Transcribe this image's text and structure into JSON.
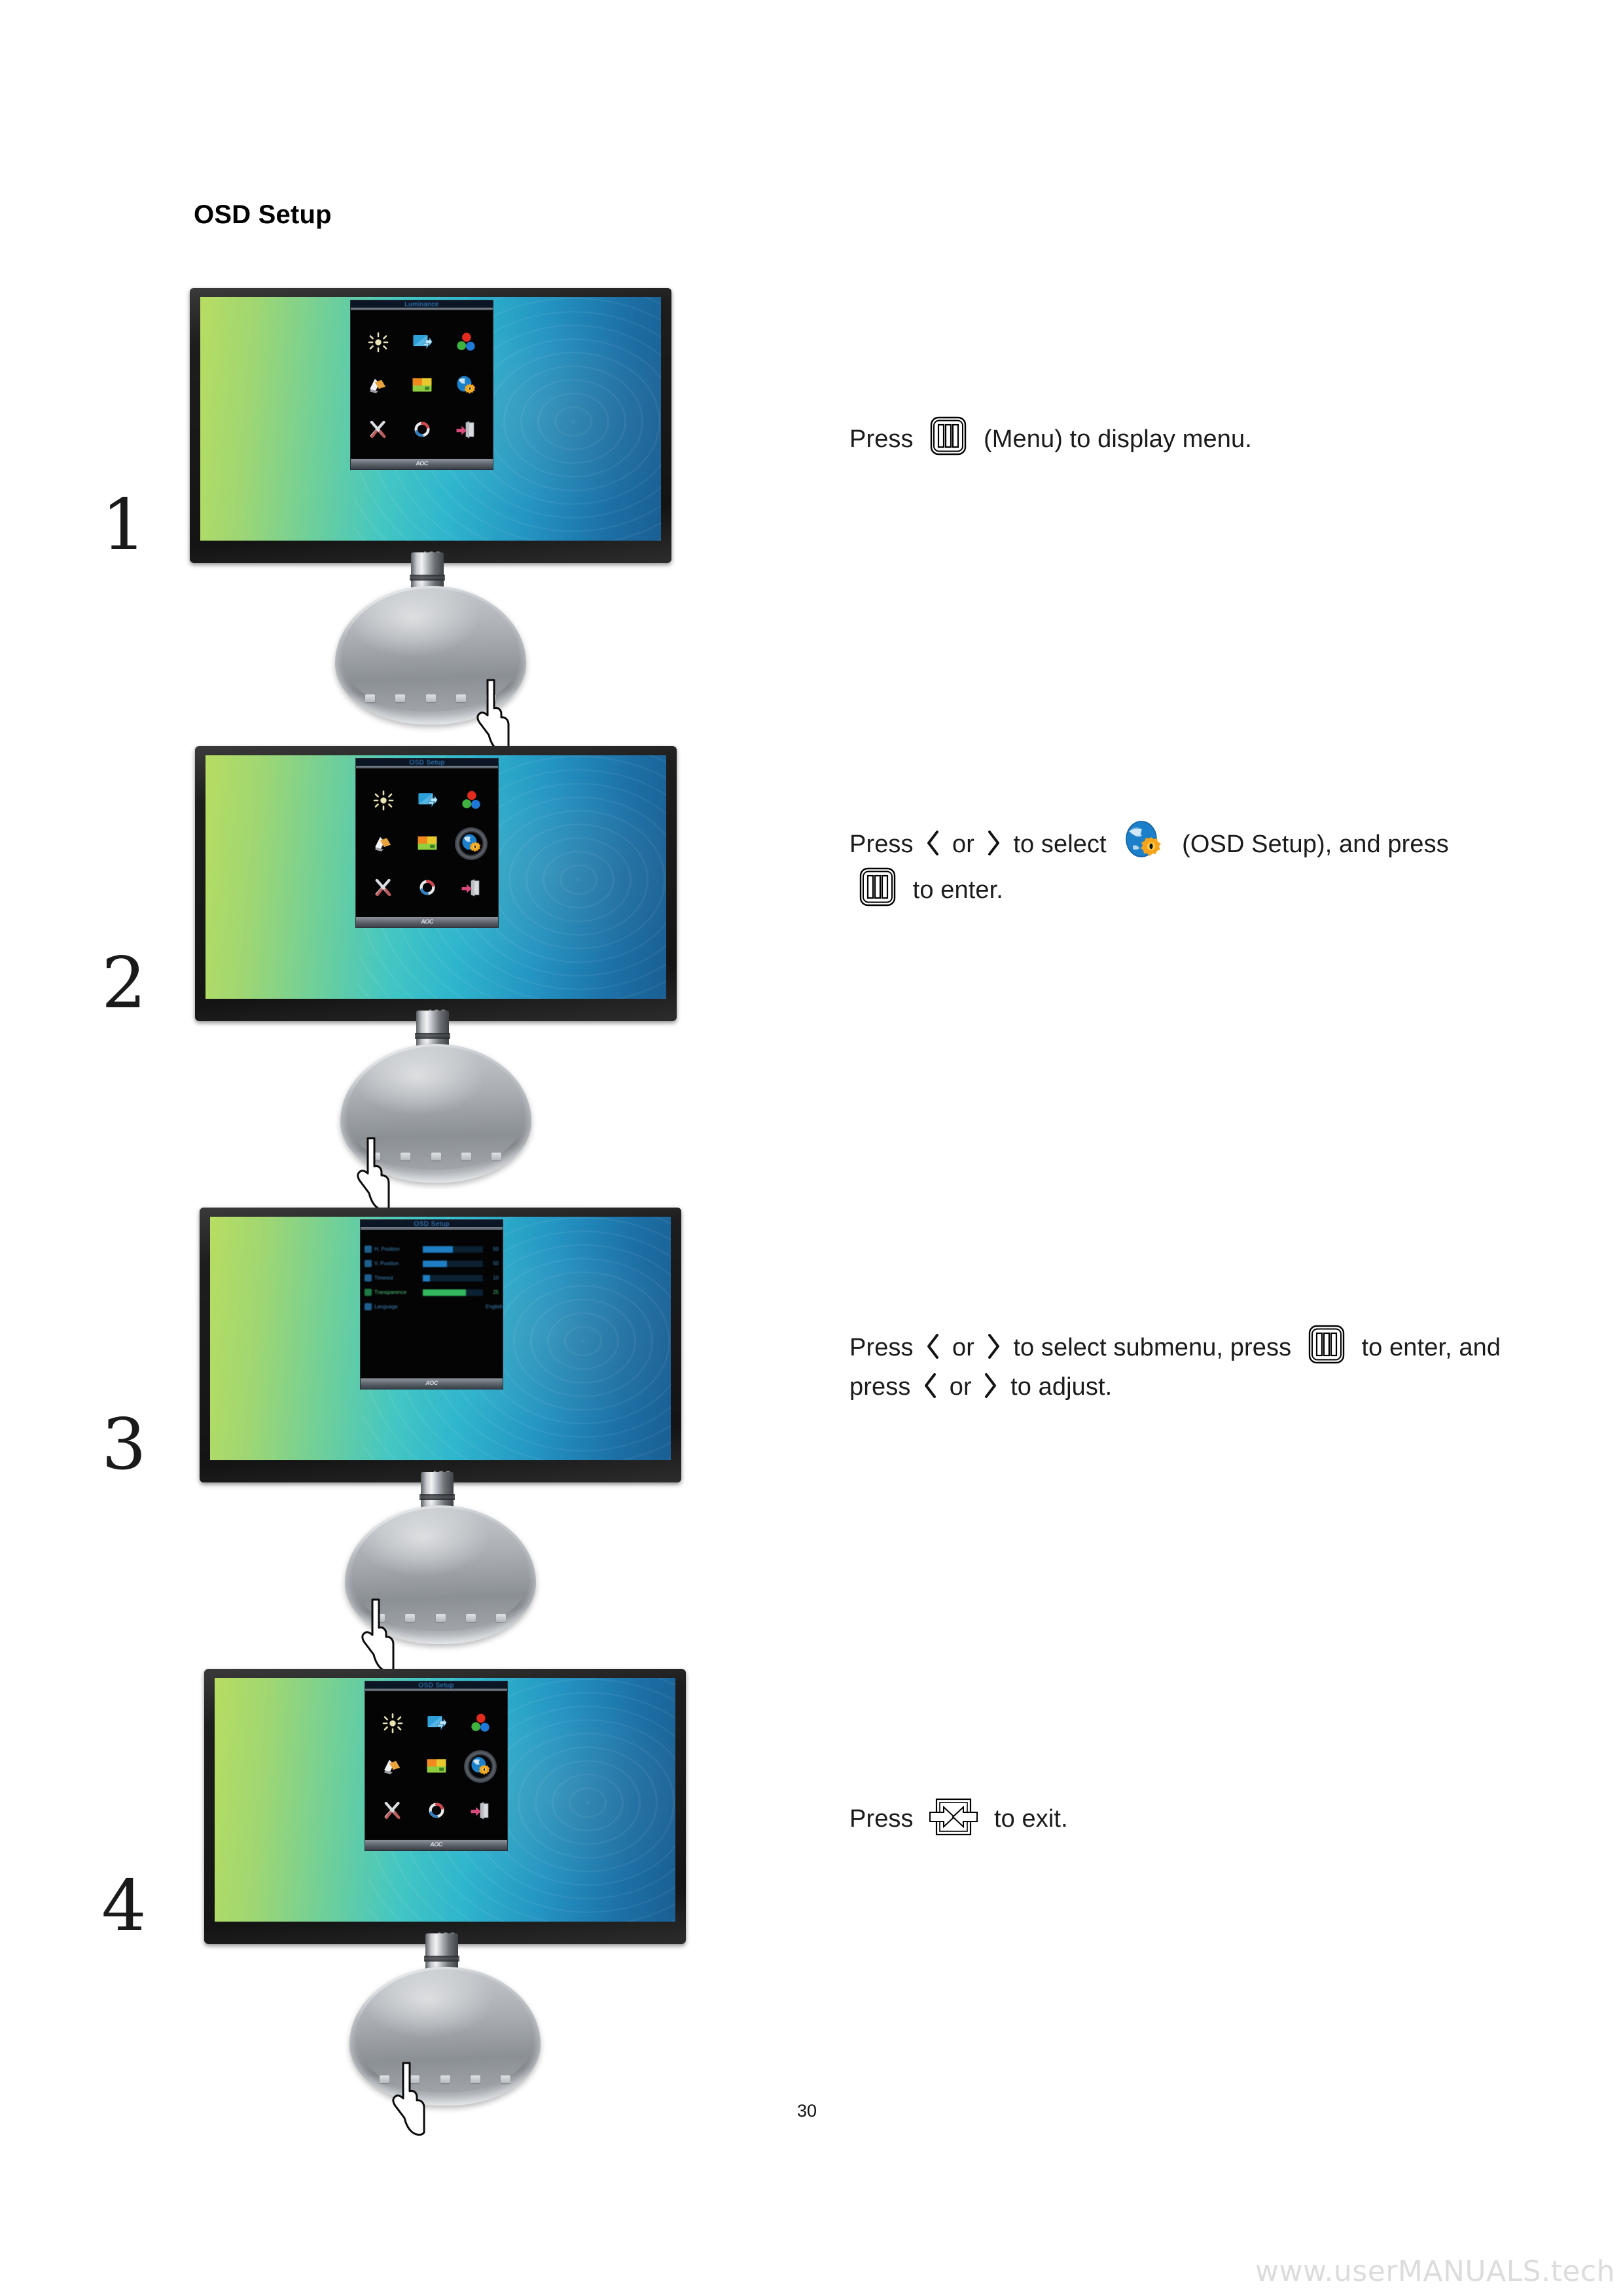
{
  "document": {
    "section_title": "OSD Setup",
    "page_number": "30",
    "watermark": "www.userMANUALS.tech"
  },
  "steps": [
    {
      "number": "1",
      "instruction_parts": [
        "Press",
        "(Menu) to display menu."
      ],
      "icons": [
        "menu-key-icon"
      ],
      "monitor": {
        "brand_logo": "AOC",
        "osd_title": "Luminance",
        "osd_footer_logo": "AOC",
        "screen_type": "main-menu-grid",
        "selected_item": ""
      }
    },
    {
      "number": "2",
      "instruction_parts": [
        "Press",
        "or",
        "to select",
        "(OSD Setup), and press",
        "to enter."
      ],
      "icons": [
        "chevron-left-icon",
        "chevron-right-icon",
        "osd-setup-globe-gear-icon",
        "menu-key-icon"
      ],
      "monitor": {
        "brand_logo": "AOC",
        "osd_title": "OSD Setup",
        "osd_footer_logo": "AOC",
        "screen_type": "main-menu-grid",
        "selected_item": "osd-setup"
      }
    },
    {
      "number": "3",
      "instruction_parts": [
        "Press",
        "or",
        "to select submenu, press",
        "to enter, and press",
        "or",
        "to adjust."
      ],
      "icons": [
        "chevron-left-icon",
        "chevron-right-icon",
        "menu-key-icon",
        "chevron-left-icon",
        "chevron-right-icon"
      ],
      "monitor": {
        "brand_logo": "AOC",
        "osd_title": "OSD Setup",
        "osd_footer_logo": "AOC",
        "screen_type": "submenu-sliders",
        "selected_item": ""
      },
      "submenu_rows": [
        {
          "label": "H. Position",
          "value": "50",
          "fill_pct": 50,
          "active": false
        },
        {
          "label": "V. Position",
          "value": "50",
          "fill_pct": 40,
          "active": false
        },
        {
          "label": "Timeout",
          "value": "10",
          "fill_pct": 12,
          "active": false
        },
        {
          "label": "Transparence",
          "value": "25",
          "fill_pct": 72,
          "active": true
        },
        {
          "label": "Language",
          "value": "English",
          "fill_pct": 0,
          "active": false
        }
      ]
    },
    {
      "number": "4",
      "instruction_parts": [
        "Press",
        "to exit."
      ],
      "icons": [
        "exit-key-icon"
      ],
      "monitor": {
        "brand_logo": "AOC",
        "osd_title": "OSD Setup",
        "osd_footer_logo": "AOC",
        "screen_type": "main-menu-grid",
        "selected_item": "osd-setup"
      }
    }
  ],
  "osd_menu_icons": [
    "luminance-sun-icon",
    "image-setup-icon",
    "color-setup-icon",
    "picture-boost-icon",
    "picture-in-picture-icon",
    "osd-setup-globe-gear-icon",
    "extra-tools-icon",
    "reset-circle-icon",
    "exit-door-icon"
  ],
  "colors": {
    "screen_gradient_start": "#b7dd62",
    "screen_gradient_mid": "#43c6c3",
    "screen_gradient_end": "#1a5f94",
    "bezel": "#1d1d1d",
    "stand": "#a9adb2",
    "osd_background": "#050506",
    "osd_title_text": "#3c8fd6",
    "osd_slider_blue": "#1f7fc4",
    "osd_slider_green": "#33b85e",
    "watermark": "#dcdcdc",
    "text": "#1b1b1b"
  }
}
